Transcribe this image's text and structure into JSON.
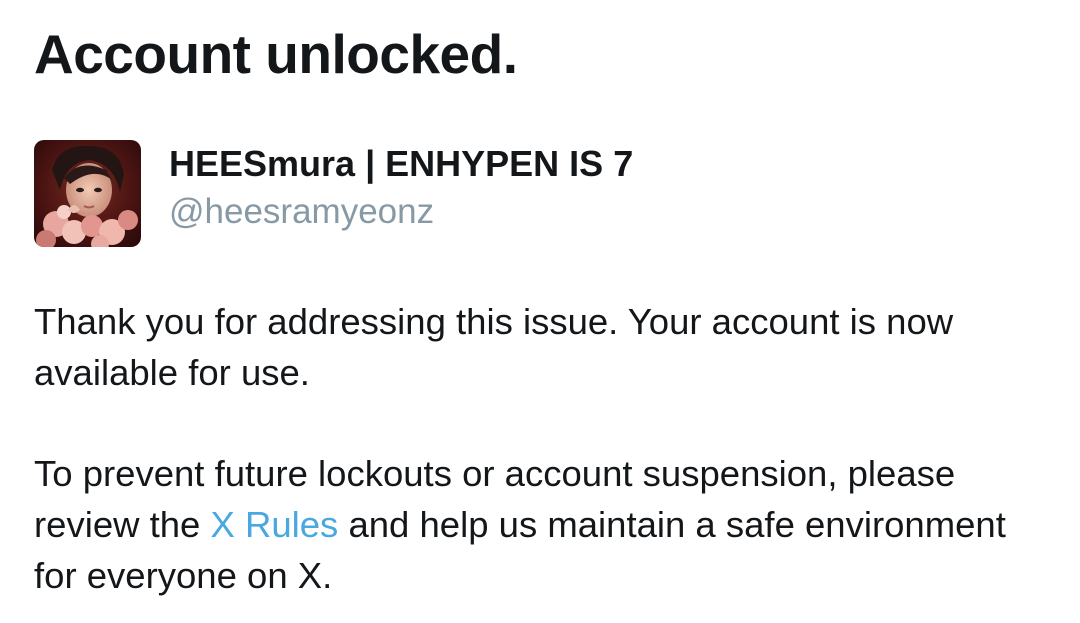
{
  "title": "Account unlocked.",
  "account": {
    "display_name": "HEESmura | ENHYPEN IS 7",
    "handle": "@heesramyeonz",
    "avatar_icon": "profile-photo"
  },
  "message": {
    "paragraph1": "Thank you for addressing this issue. Your account is now available for use.",
    "paragraph2_before": "To prevent future lockouts or account suspension, please review the ",
    "paragraph2_link": "X Rules",
    "paragraph2_after": " and help us maintain a safe environment for everyone on X."
  },
  "colors": {
    "text": "#14171a",
    "secondary_text": "#8899a6",
    "link": "#4aa8e0",
    "background": "#ffffff"
  }
}
